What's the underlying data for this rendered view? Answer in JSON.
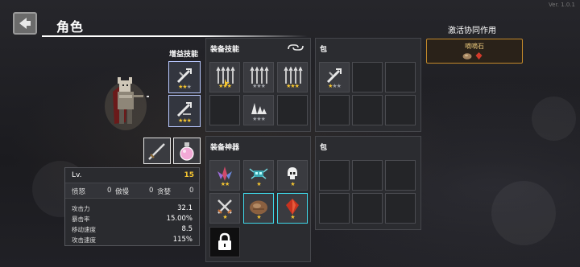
{
  "app": {
    "version": "Ver. 1.0.1"
  },
  "header": {
    "title": "角色"
  },
  "synergy": {
    "title": "激活协同作用",
    "item_name": "嘀嘀石"
  },
  "boost": {
    "label": "增益技能"
  },
  "skills_panel": {
    "title": "装备技能"
  },
  "bag_top": {
    "title": "包"
  },
  "artifacts_panel": {
    "title": "装备神器"
  },
  "bag_bottom": {
    "title": "包"
  },
  "stats": {
    "lv_label": "Lv.",
    "lv_value": "15",
    "traits": [
      {
        "name": "愤怒",
        "value": "0"
      },
      {
        "name": "傲慢",
        "value": "0"
      },
      {
        "name": "贪婪",
        "value": "0"
      }
    ],
    "rows": [
      {
        "label": "攻击力",
        "value": "32.1"
      },
      {
        "label": "暴击率",
        "value": "15.00%"
      },
      {
        "label": "移动速度",
        "value": "8.5"
      },
      {
        "label": "攻击速度",
        "value": "115%"
      }
    ]
  },
  "colors": {
    "accent_gold": "#f4c430",
    "synergy_border": "#c48a2a",
    "artifact_highlight": "#3fd8e8"
  }
}
